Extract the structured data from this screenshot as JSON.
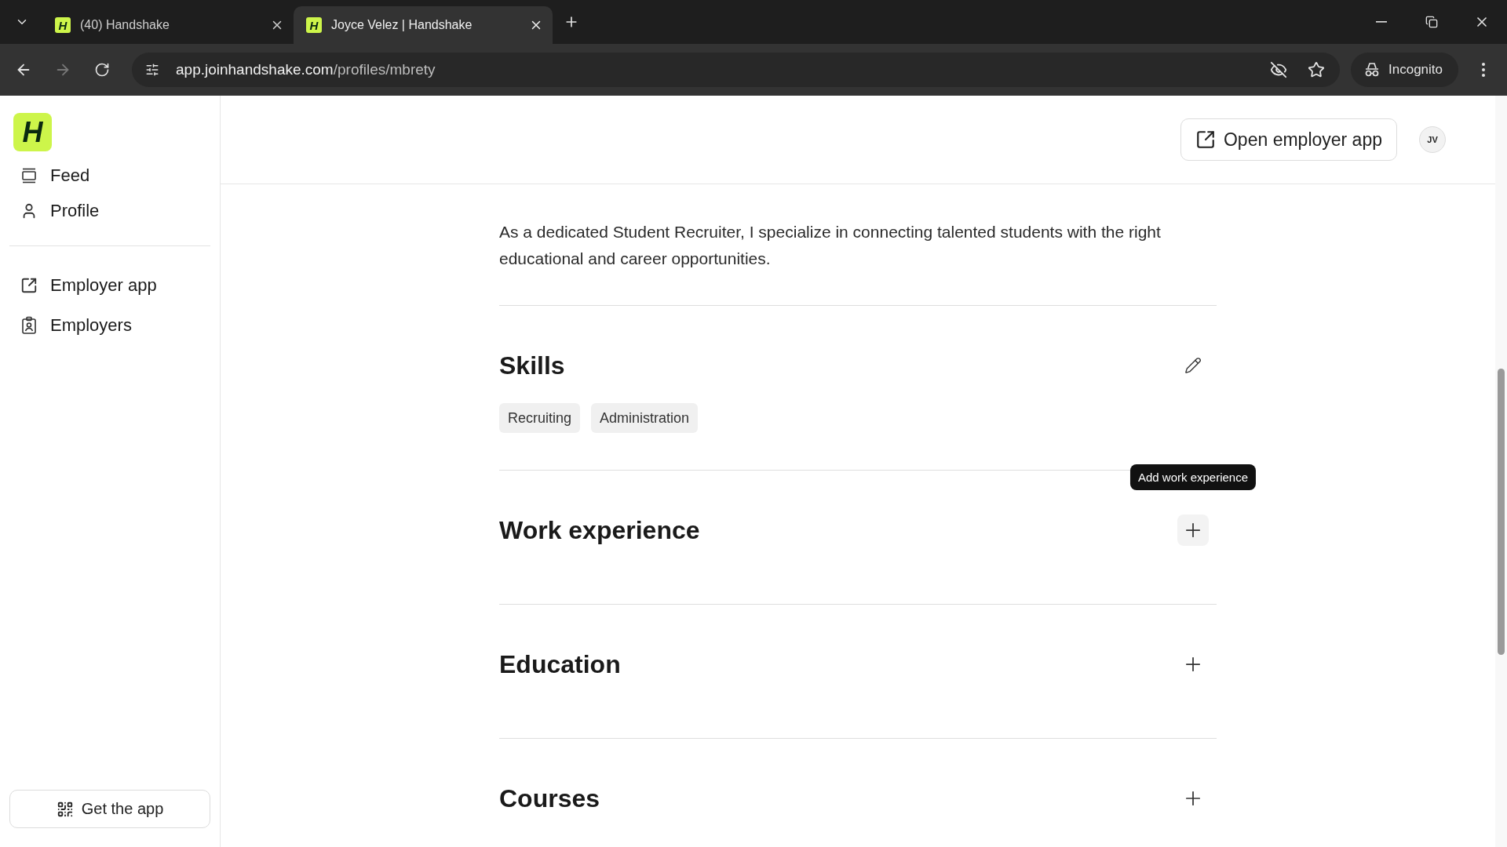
{
  "browser": {
    "tabs": [
      {
        "favicon": "H",
        "title": "(40) Handshake",
        "selected": false
      },
      {
        "favicon": "H",
        "title": "Joyce Velez | Handshake",
        "selected": true
      }
    ],
    "url_host": "app.joinhandshake.com",
    "url_path": "/profiles/mbrety",
    "profile_label": "Incognito"
  },
  "sidebar": {
    "logo": "H",
    "nav": [
      {
        "label": "Feed",
        "kind": "feed"
      },
      {
        "label": "Profile",
        "kind": "profile"
      },
      {
        "label": "Employer app",
        "kind": "external"
      },
      {
        "label": "Employers",
        "kind": "badge"
      }
    ],
    "get_app": "Get the app"
  },
  "header": {
    "open_employer_app": "Open employer app",
    "avatar": "JV"
  },
  "profile": {
    "summary": "As a dedicated Student Recruiter, I specialize in connecting talented students with the right educational and career opportunities.",
    "sections": [
      {
        "title": "Skills",
        "kind": "edit",
        "chips": [
          "Recruiting",
          "Administration"
        ]
      },
      {
        "title": "Work experience",
        "kind": "add",
        "tooltip": "Add work experience"
      },
      {
        "title": "Education",
        "kind": "add"
      },
      {
        "title": "Courses",
        "kind": "add"
      }
    ]
  }
}
